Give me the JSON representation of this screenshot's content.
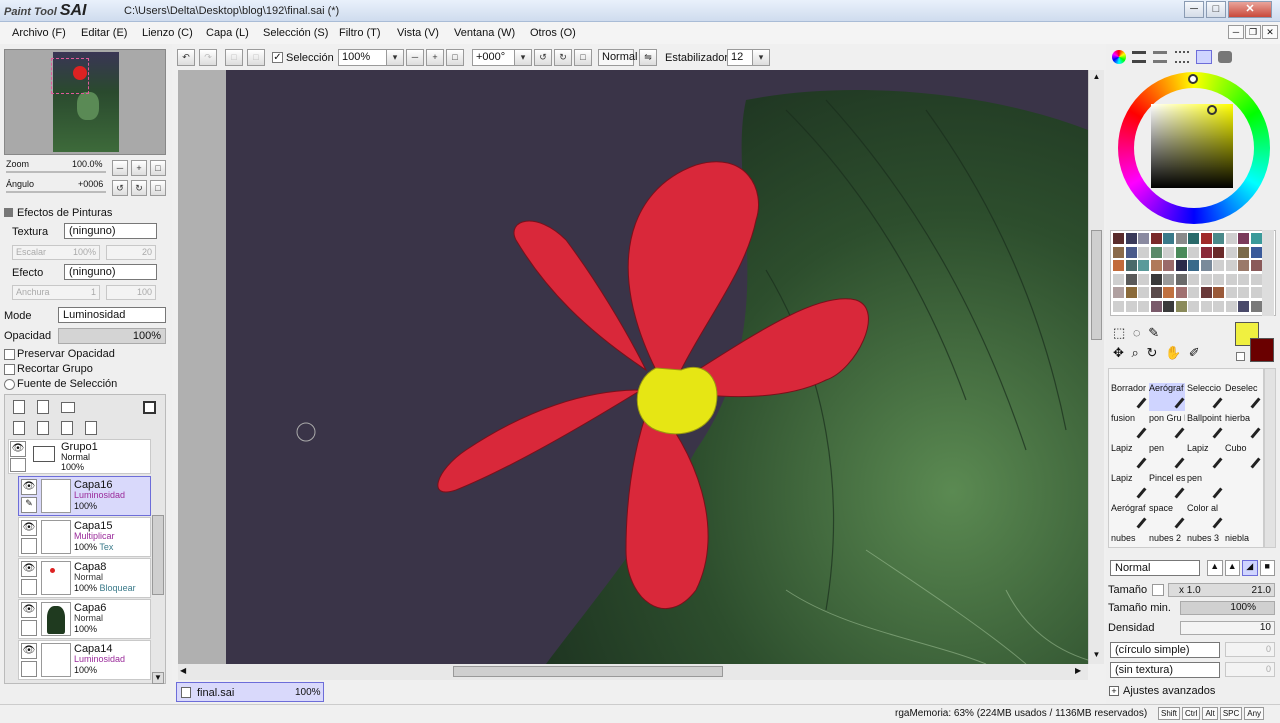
{
  "app": {
    "logo_small": "Paint Tool",
    "logo_big": "SAI",
    "title": "C:\\Users\\Delta\\Desktop\\blog\\192\\final.sai (*)"
  },
  "menu": [
    "Archivo (F)",
    "Editar (E)",
    "Lienzo (C)",
    "Capa (L)",
    "Selección (S)",
    "Filtro (T)",
    "Vista (V)",
    "Ventana (W)",
    "Otros (O)"
  ],
  "toolbar": {
    "selection_label": "Selección",
    "zoom": "100%",
    "angle": "+000°",
    "blend": "Normal",
    "stabilizer_label": "Estabilizador",
    "stabilizer": "12"
  },
  "navigator": {
    "zoom_label": "Zoom",
    "zoom_value": "100.0%",
    "angle_label": "Ángulo",
    "angle_value": "+0006"
  },
  "effects": {
    "title": "Efectos de Pinturas",
    "texture_label": "Textura",
    "texture_value": "(ninguno)",
    "scale_label": "Escalar",
    "scale_value": "100%",
    "scale_num": "20",
    "effect_label": "Efecto",
    "effect_value": "(ninguno)",
    "width_label": "Anchura",
    "width_value": "1",
    "width_num": "100"
  },
  "layer_props": {
    "mode_label": "Mode",
    "mode_value": "Luminosidad",
    "opacity_label": "Opacidad",
    "opacity_value": "100%",
    "preserve_opacity": "Preservar Opacidad",
    "clip_group": "Recortar Grupo",
    "selection_source": "Fuente de Selección"
  },
  "layers": {
    "group": {
      "name": "Grupo1",
      "mode": "Normal",
      "opacity": "100%"
    },
    "items": [
      {
        "name": "Capa16",
        "mode": "Luminosidad",
        "opacity": "100%",
        "extra": ""
      },
      {
        "name": "Capa15",
        "mode": "Multiplicar",
        "opacity": "100%",
        "extra": "Tex"
      },
      {
        "name": "Capa8",
        "mode": "Normal",
        "opacity": "100%",
        "extra": "Bloquear"
      },
      {
        "name": "Capa6",
        "mode": "Normal",
        "opacity": "100%",
        "extra": ""
      },
      {
        "name": "Capa14",
        "mode": "Luminosidad",
        "opacity": "100%",
        "extra": ""
      }
    ]
  },
  "doc_tab": {
    "name": "final.sai",
    "zoom": "100%"
  },
  "tools": [
    [
      "Borrador",
      "Aerógraf",
      "Seleccio",
      "Deselec"
    ],
    [
      "fusion",
      "pon Gru Pen",
      "Ballpoint Pen",
      "hierba"
    ],
    [
      "Lapiz",
      "pen",
      "Lapiz",
      "Cubo"
    ],
    [
      "Lapiz",
      "Pincel es",
      "pen",
      ""
    ],
    [
      "Aerógraf",
      "space",
      "Color al",
      ""
    ],
    [
      "nubes",
      "nubes 2",
      "nubes 3",
      "niebla"
    ]
  ],
  "brush": {
    "mode": "Normal",
    "size_label": "Tamaño",
    "size_mult": "x 1.0",
    "size_value": "21.0",
    "min_size_label": "Tamaño min.",
    "min_size_value": "100%",
    "density_label": "Densidad",
    "density_value": "10",
    "shape": "(círculo simple)",
    "shape_num": "0",
    "texture": "(sin textura)",
    "texture_num": "0",
    "advanced": "Ajustes avanzados"
  },
  "status": {
    "memory": "rgaMemoria: 63% (224MB usados / 1136MB reservados)",
    "keys": [
      "Shift",
      "Ctrl",
      "Alt",
      "SPC",
      "Any"
    ]
  },
  "colors": {
    "primary": "#f0f040",
    "secondary": "#6a0000",
    "accent": "#6d6dd9"
  },
  "palette": [
    "#5a2c2c",
    "#3a3a5a",
    "#8a8aa0",
    "#7a2a2a",
    "#3a7a8a",
    "#8a8a8a",
    "#2a6a6a",
    "#a02a2a",
    "#4a8a8a",
    "#cfcfcf",
    "#7a3a5a",
    "#3a9a9a",
    "#8a6a4a",
    "#4a5a8a",
    "#cfcfcf",
    "#5a8a6a",
    "#cfcfcf",
    "#4a8a5a",
    "#cfcfcf",
    "#8a2a3a",
    "#6a2a2a",
    "#cfcfcf",
    "#7a6a4a",
    "#3a5a9a",
    "#c26a3a",
    "#4a6a6a",
    "#5a9a9a",
    "#b07a5a",
    "#9a6a6a",
    "#2a2a4a",
    "#3a6a8a",
    "#7a8a9a",
    "#cfcfcf",
    "#cfcfcf",
    "#9a7a6a",
    "#8a5a5a",
    "#cfcfcf",
    "#5a5a5a",
    "#cfcfcf",
    "#3a3a3a",
    "#9a9a9a",
    "#6a6a6a",
    "#cfcfcf",
    "#cfcfcf",
    "#cfcfcf",
    "#cfcfcf",
    "#cfcfcf",
    "#cfcfcf",
    "#b0a0a0",
    "#8a6a3a",
    "#cfcfcf",
    "#5a4a4a",
    "#c07040",
    "#a07070",
    "#cfcfcf",
    "#6a3a3a",
    "#9a5a3a",
    "#cfcfcf",
    "#cfcfcf",
    "#cfcfcf",
    "#cfcfcf",
    "#cfcfcf",
    "#cfcfcf",
    "#7a5a6a",
    "#3a3a3a",
    "#8a8a5a",
    "#cfcfcf",
    "#cfcfcf",
    "#cfcfcf",
    "#cfcfcf",
    "#4a4a6a",
    "#7a7a7a"
  ]
}
